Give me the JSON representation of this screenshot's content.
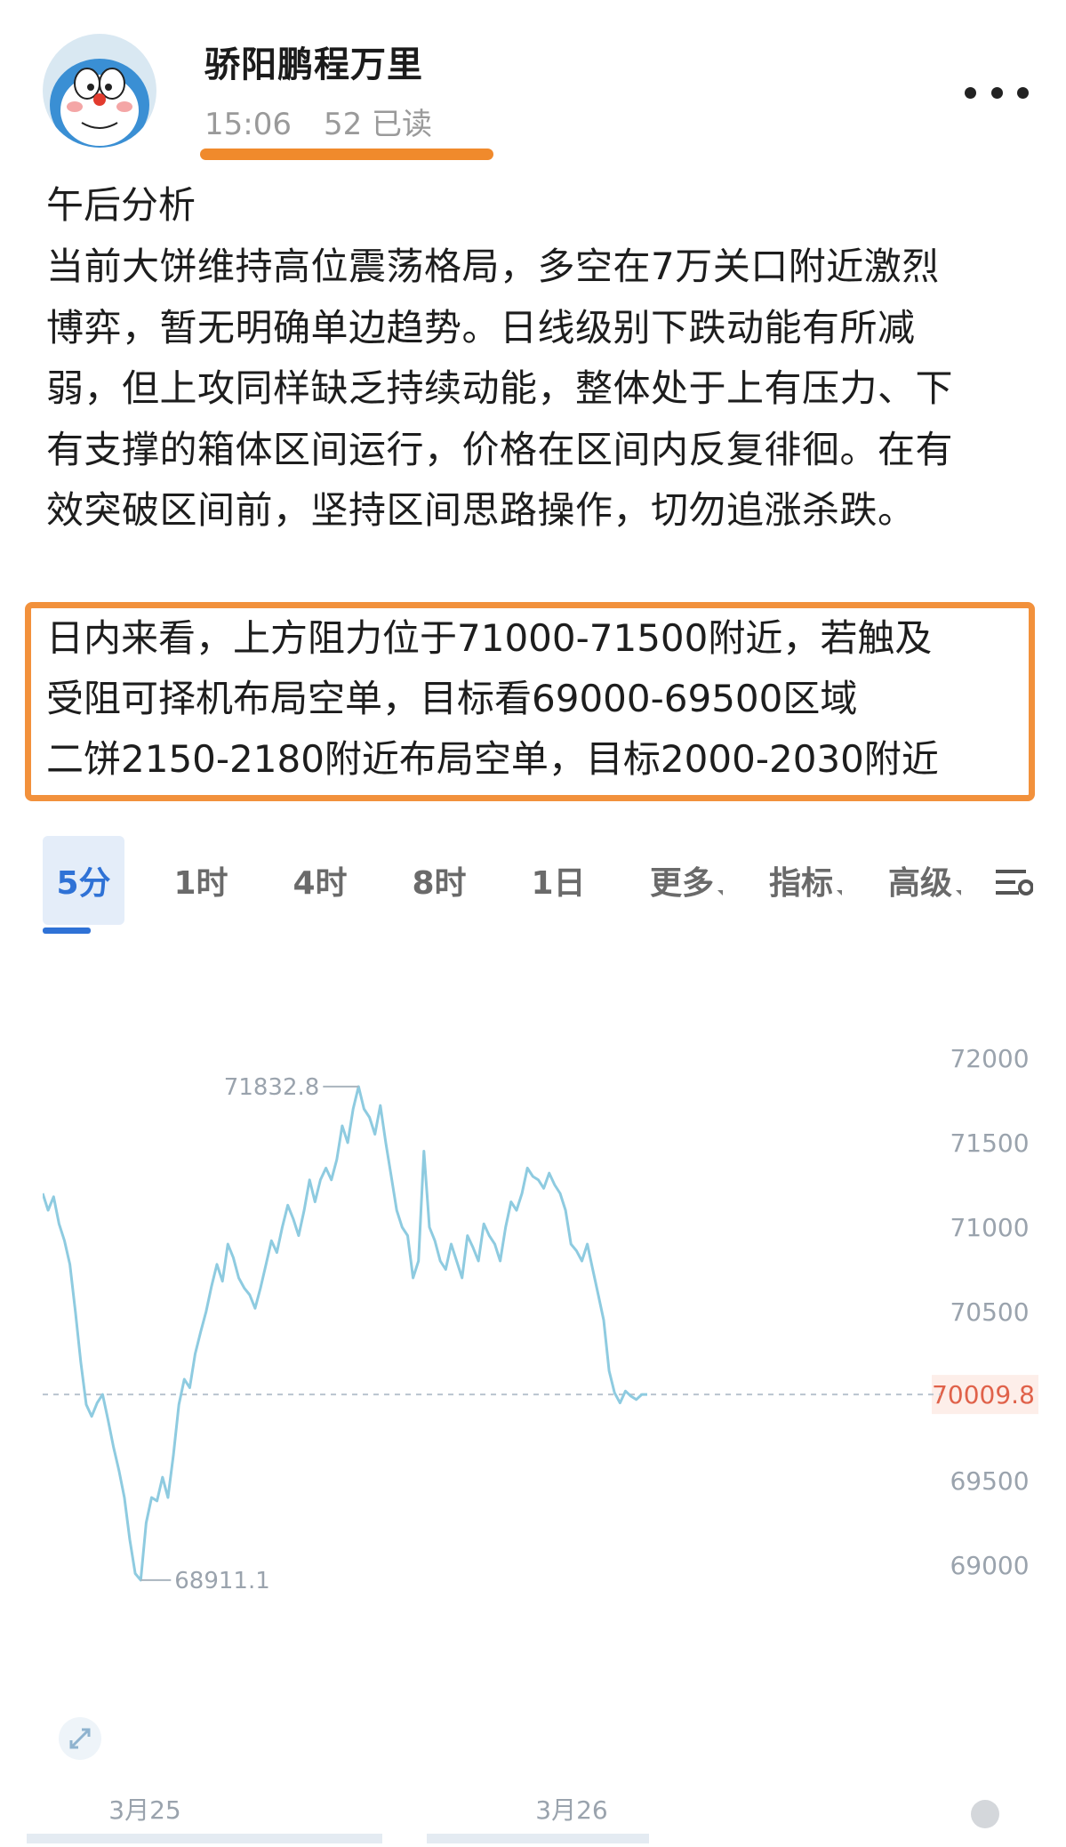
{
  "post": {
    "author": "骄阳鹏程万里",
    "time": "15:06",
    "reads": "52 已读",
    "title": "午后分析",
    "paragraph_lines": [
      "当前大饼维持高位震荡格局，多空在7万关口附近激烈",
      "博弈，暂无明确单边趋势。日线级别下跌动能有所减",
      "弱，但上攻同样缺乏持续动能，整体处于上有压力、下",
      "有支撑的箱体区间运行，价格在区间内反复徘徊。在有",
      "效突破区间前，坚持区间思路操作，切勿追涨杀跌。"
    ],
    "highlight_lines": [
      "日内来看，上方阻力位于71000-71500附近，若触及",
      "受阻可择机布局空单，目标看69000-69500区域",
      "二饼2150-2180附近布局空单，目标2000-2030附近"
    ]
  },
  "tabs": [
    {
      "label": "5分",
      "active": true
    },
    {
      "label": "1时"
    },
    {
      "label": "4时"
    },
    {
      "label": "8时"
    },
    {
      "label": "1日"
    },
    {
      "label": "更多"
    },
    {
      "label": "指标"
    },
    {
      "label": "高级"
    }
  ],
  "icons": {
    "more": "more-dots-icon",
    "filter": "settings-lines-icon",
    "expand": "expand-arrows-icon",
    "avatar": "doraemon-avatar"
  },
  "colors": {
    "accent": "#f08a2c",
    "line": "#8ecbe0",
    "tab_active": "#2f72d6",
    "price_label": "#e0624a"
  },
  "chart_data": {
    "type": "line",
    "x": [
      0,
      1,
      2,
      3,
      4,
      5,
      6,
      7,
      8,
      9,
      10,
      11,
      12,
      13,
      14,
      15,
      16,
      17,
      18,
      19,
      20,
      21,
      22,
      23,
      24,
      25,
      26,
      27,
      28,
      29,
      30,
      31,
      32,
      33,
      34,
      35,
      36,
      37,
      38,
      39,
      40,
      41,
      42,
      43,
      44,
      45,
      46,
      47,
      48,
      49,
      50,
      51,
      52,
      53,
      54,
      55,
      56,
      57,
      58,
      59,
      60,
      61,
      62,
      63,
      64,
      65,
      66,
      67,
      68,
      69,
      70,
      71,
      72,
      73,
      74,
      75,
      76,
      77,
      78,
      79,
      80,
      81,
      82,
      83,
      84,
      85,
      86,
      87,
      88,
      89,
      90,
      91,
      92,
      93,
      94,
      95,
      96,
      97,
      98,
      99,
      100,
      101,
      102,
      103,
      104,
      105,
      106,
      107,
      108,
      109,
      110,
      111,
      112,
      113,
      114,
      115,
      116,
      117,
      118,
      119,
      120,
      121
    ],
    "values": [
      71200,
      71100,
      71180,
      71020,
      70920,
      70780,
      70500,
      70200,
      69950,
      69880,
      69960,
      70010,
      69860,
      69700,
      69560,
      69400,
      69150,
      68950,
      68911,
      69250,
      69400,
      69380,
      69520,
      69400,
      69650,
      69950,
      70100,
      70050,
      70250,
      70380,
      70500,
      70650,
      70780,
      70680,
      70900,
      70820,
      70700,
      70640,
      70600,
      70520,
      70640,
      70780,
      70920,
      70850,
      71000,
      71130,
      71050,
      70950,
      71100,
      71280,
      71150,
      71280,
      71350,
      71280,
      71400,
      71600,
      71500,
      71700,
      71832,
      71700,
      71650,
      71550,
      71720,
      71500,
      71300,
      71100,
      71000,
      70950,
      70700,
      70800,
      71450,
      71000,
      70920,
      70800,
      70750,
      70900,
      70800,
      70700,
      70950,
      70880,
      70800,
      71020,
      70950,
      70900,
      70800,
      71000,
      71150,
      71100,
      71200,
      71350,
      71300,
      71280,
      71230,
      71320,
      71250,
      71200,
      71100,
      70900,
      70860,
      70800,
      70900,
      70750,
      70600,
      70450,
      70150,
      70020,
      69960,
      70030,
      70000,
      69980,
      70010,
      70009.8
    ],
    "ylim": [
      68800,
      72300
    ],
    "yticks": [
      "72000",
      "71500",
      "71000",
      "70500",
      "70000",
      "69500",
      "69000"
    ],
    "xticks": [
      "3月25",
      "3月26"
    ],
    "high_label": "71832.8",
    "low_label": "68911.1",
    "last_label": "70009.8",
    "grid": false
  }
}
